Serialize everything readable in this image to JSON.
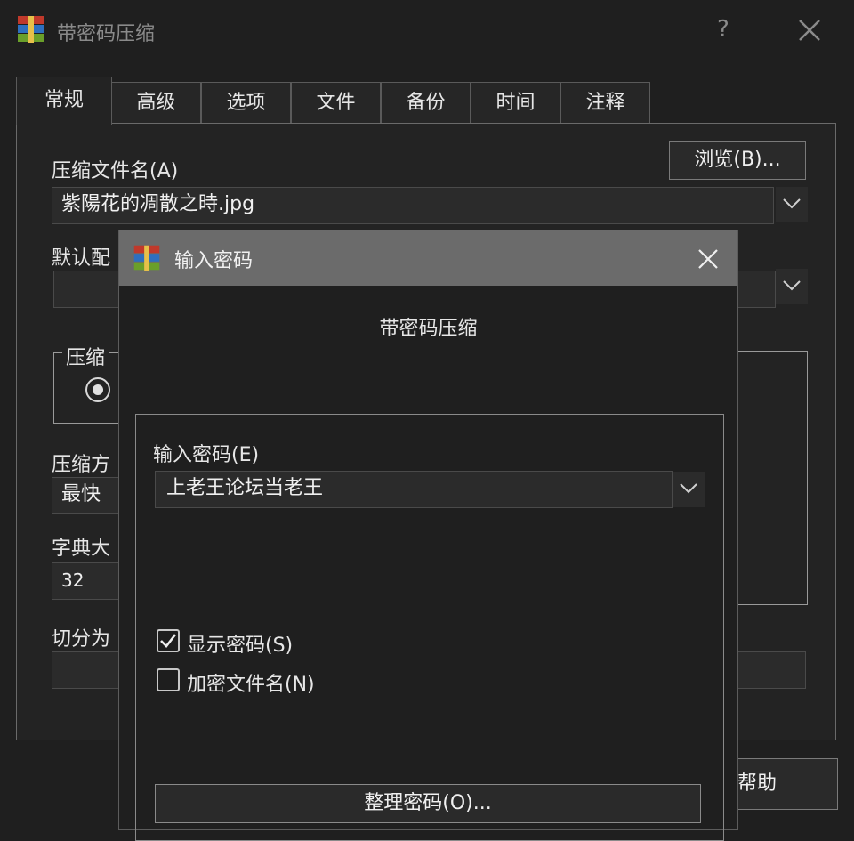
{
  "window": {
    "title": "带密码压缩",
    "help_icon": "?",
    "close_icon": "close-icon"
  },
  "tabs": [
    "常规",
    "高级",
    "选项",
    "文件",
    "备份",
    "时间",
    "注释"
  ],
  "general": {
    "archive_name_label": "压缩文件名(A)",
    "browse_button": "浏览(B)...",
    "archive_name_value": "紫陽花的凋散之時.jpg",
    "default_profile_label": "默认配",
    "format_group_label": "压缩",
    "method_label": "压缩方",
    "method_value": "最快",
    "dict_label": "字典大",
    "dict_value": "32",
    "split_label": "切分为",
    "help_button": "帮助"
  },
  "dialog": {
    "title": "输入密码",
    "heading": "带密码压缩",
    "password_label": "输入密码(E)",
    "password_value": "上老王论坛当老王",
    "show_password_label": "显示密码(S)",
    "show_password_checked": true,
    "encrypt_names_label": "加密文件名(N)",
    "encrypt_names_checked": false,
    "organize_button": "整理密码(O)..."
  }
}
